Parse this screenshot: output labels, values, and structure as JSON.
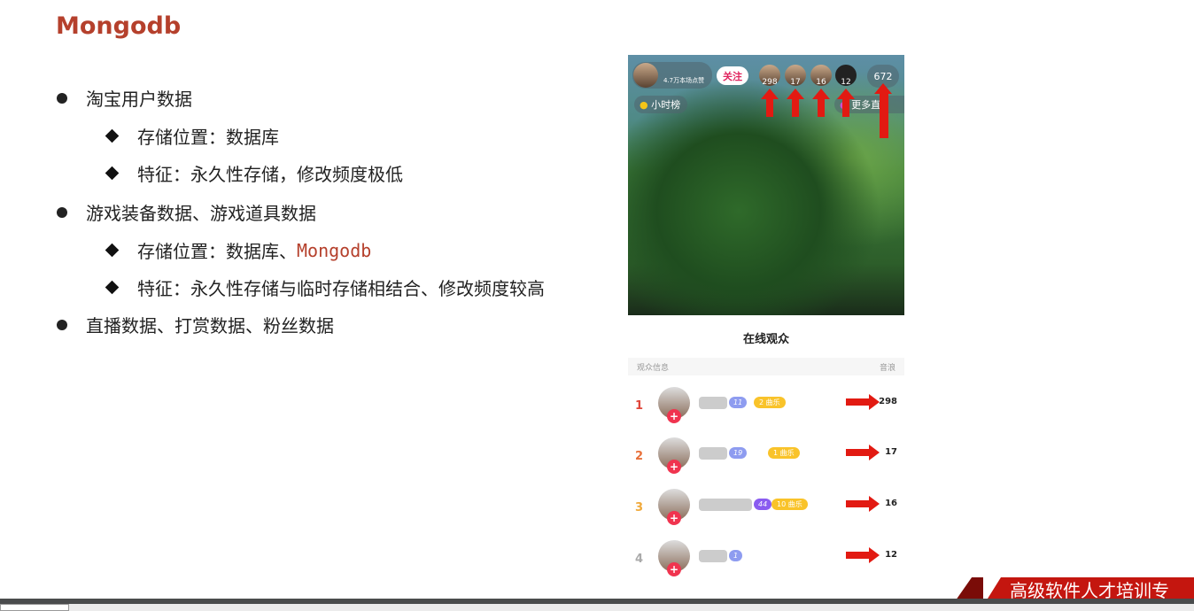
{
  "slide": {
    "title": "Mongodb",
    "bullets": [
      {
        "text": "淘宝用户数据",
        "sub": [
          "存储位置：数据库",
          "特征：永久性存储，修改频度极低"
        ]
      },
      {
        "text": "游戏装备数据、游戏道具数据",
        "sub": [
          {
            "prefix": "存储位置：数据库、",
            "code": "Mongodb"
          },
          "特征：永久性存储与临时存储相结合、修改频度较高"
        ]
      },
      {
        "text": "直播数据、打赏数据、粉丝数据"
      }
    ]
  },
  "live": {
    "host_likes": "4.7万本场点赞",
    "follow_label": "关注",
    "top_viewers": [
      "298",
      "17",
      "16",
      "12"
    ],
    "online_count": "672",
    "hour_rank_label": "小时榜",
    "more_label": "更多直"
  },
  "audience": {
    "title": "在线观众",
    "col_info": "观众信息",
    "col_value": "音浪",
    "rows": [
      {
        "rank": "1",
        "level": "11",
        "fan_level": "2",
        "fan_label": "曲乐",
        "value": "298",
        "rank_color": "#e0453a"
      },
      {
        "rank": "2",
        "level": "19",
        "fan_level": "1",
        "fan_label": "曲乐",
        "value": "17",
        "rank_color": "#e8703a"
      },
      {
        "rank": "3",
        "level": "44",
        "fan_level": "10",
        "fan_label": "曲乐",
        "value": "16",
        "rank_color": "#f0a93a"
      },
      {
        "rank": "4",
        "level": "1",
        "value": "12",
        "rank_color": "#aaaaaa"
      }
    ]
  },
  "banner": "高级软件人才培训专"
}
